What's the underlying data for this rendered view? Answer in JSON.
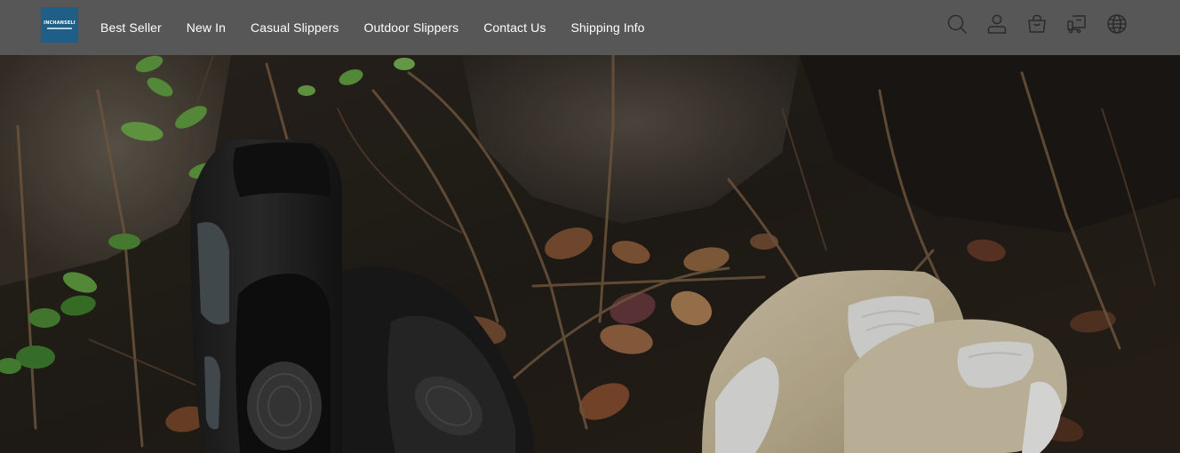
{
  "header": {
    "logo": {
      "text": "INCHANSELI"
    },
    "nav": [
      {
        "label": "Best Seller"
      },
      {
        "label": "New In"
      },
      {
        "label": "Casual Slippers"
      },
      {
        "label": "Outdoor Slippers"
      },
      {
        "label": "Contact Us"
      },
      {
        "label": "Shipping Info"
      }
    ],
    "icons": [
      "search-icon",
      "user-icon",
      "shopping-bag-icon",
      "shipping-truck-icon",
      "globe-language-icon"
    ]
  },
  "hero": {
    "image": "hero-banner-slides-on-forest-floor"
  },
  "colors": {
    "header_bg": "#575757",
    "logo_bg": "#1f5e86",
    "nav_text": "#ffffff",
    "icon_stroke": "#2b2b2b"
  }
}
